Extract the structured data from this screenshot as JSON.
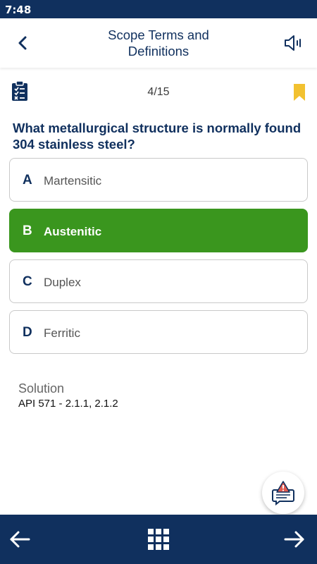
{
  "status_bar": {
    "time": "7:48"
  },
  "header": {
    "title": "Scope Terms and Definitions",
    "back_icon": "chevron-left-icon",
    "sound_icon": "speaker-icon"
  },
  "quiz": {
    "progress": "4/15",
    "clipboard_icon": "clipboard-checklist-icon",
    "bookmark_icon": "bookmark-icon",
    "question": "What metallurgical structure is normally found 304 stainless steel?",
    "options": [
      {
        "letter": "A",
        "text": "Martensitic",
        "state": "default"
      },
      {
        "letter": "B",
        "text": "Austenitic",
        "state": "correct"
      },
      {
        "letter": "C",
        "text": "Duplex",
        "state": "default"
      },
      {
        "letter": "D",
        "text": "Ferritic",
        "state": "default"
      }
    ]
  },
  "solution": {
    "label": "Solution",
    "text": "API 571 - 2.1.1, 2.1.2"
  },
  "report_icon": "report-issue-icon",
  "bottom_nav": {
    "prev_icon": "arrow-left-icon",
    "grid_icon": "grid-icon",
    "next_icon": "arrow-right-icon"
  },
  "colors": {
    "primary": "#10305e",
    "correct": "#3a961e",
    "bookmark": "#f2c130",
    "alert": "#e05a50"
  }
}
